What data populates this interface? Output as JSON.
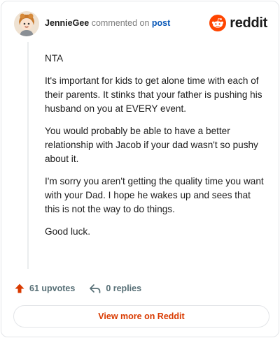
{
  "header": {
    "username": "JennieGee",
    "verb": "commented on",
    "post_link": "post",
    "brand_word": "reddit",
    "brand_color": "#ff4500"
  },
  "comment": {
    "paragraphs": [
      "NTA",
      "It's important for kids to get alone time with each of their parents. It stinks that your father is pushing his husband on you at EVERY event.",
      "You would probably be able to have a better relationship with Jacob if your dad wasn't so pushy about it.",
      "I'm sorry you aren't getting the quality time you want with your Dad. I hope he wakes up and sees that this is not the way to do things.",
      "Good luck."
    ]
  },
  "actions": {
    "upvotes_label": "61 upvotes",
    "replies_label": "0 replies",
    "upvote_icon": "upvote-arrow-icon",
    "reply_icon": "reply-arrow-icon",
    "upvote_color": "#d93a00"
  },
  "footer": {
    "view_more_label": "View more on Reddit"
  }
}
